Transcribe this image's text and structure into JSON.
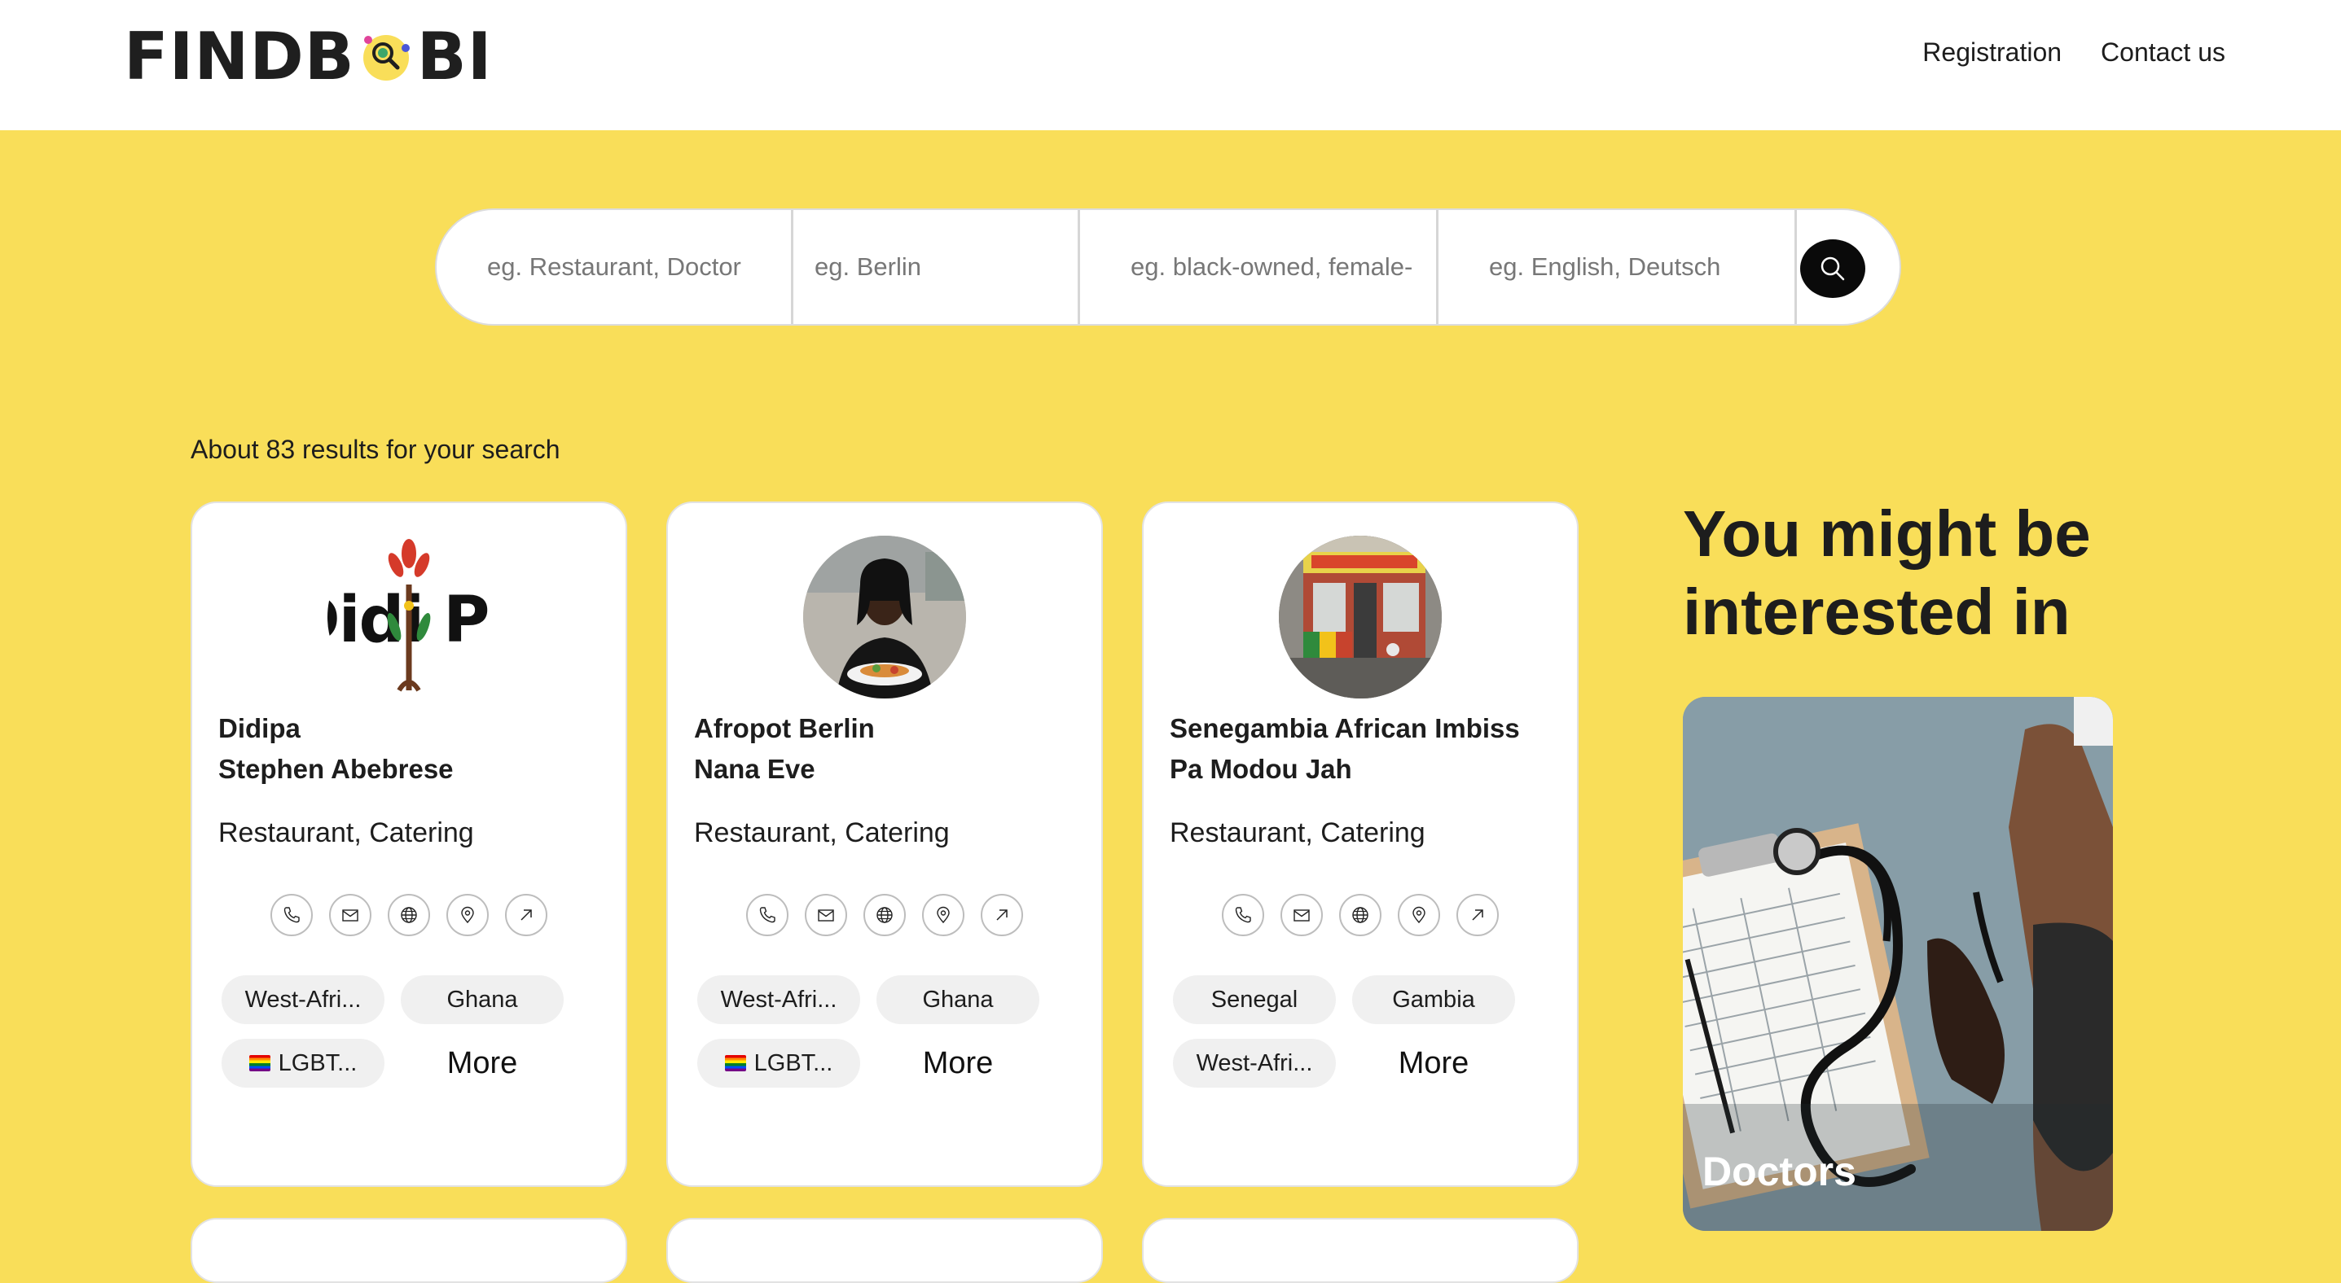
{
  "header": {
    "logo_left": "FINDB",
    "logo_right": "BI",
    "nav": [
      "Registration",
      "Contact us"
    ]
  },
  "search": {
    "what_placeholder": "eg. Restaurant, Doctor",
    "where_placeholder": "eg. Berlin",
    "attributes_placeholder": "eg. black-owned, female-",
    "language_placeholder": "eg. English, Deutsch",
    "button_icon": "search-icon"
  },
  "results": {
    "count_text": "About 83 results for your search",
    "cards": [
      {
        "business": "Didipa",
        "owner": "Stephen Abebrese",
        "category": "Restaurant, Catering",
        "tags": [
          "West-Afri...",
          "Ghana",
          "LGBT..."
        ],
        "more": "More",
        "logo_text": "Didi Po"
      },
      {
        "business": "Afropot Berlin",
        "owner": "Nana Eve",
        "category": "Restaurant, Catering",
        "tags": [
          "West-Afri...",
          "Ghana",
          "LGBT..."
        ],
        "more": "More"
      },
      {
        "business": "Senegambia African Imbiss",
        "owner": "Pa Modou Jah",
        "category": "Restaurant, Catering",
        "tags": [
          "Senegal",
          "Gambia",
          "West-Afri..."
        ],
        "more": "More"
      }
    ],
    "action_icons": [
      "phone-icon",
      "mail-icon",
      "globe-icon",
      "map-pin-icon",
      "external-link-icon"
    ]
  },
  "side": {
    "title": "You might be interested in",
    "card_label": "Doctors"
  },
  "colors": {
    "background": "#f9de59",
    "header": "#ffffff",
    "text": "#1d1d1d",
    "tag_bg": "#f0f0f0"
  }
}
